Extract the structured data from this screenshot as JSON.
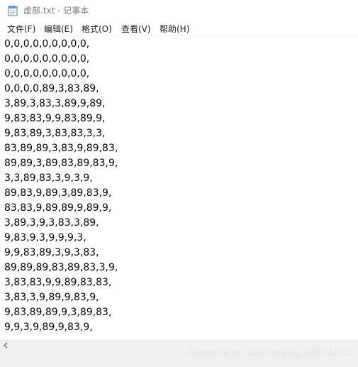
{
  "window": {
    "title": "虚部.txt - 记事本"
  },
  "menu": {
    "file": "文件(F)",
    "edit": "编辑(E)",
    "format": "格式(O)",
    "view": "查看(V)",
    "help": "帮助(H)"
  },
  "document": {
    "lines": [
      "0,0,0,0,0,0,0,0,0,",
      "0,0,0,0,0,0,0,0,0,",
      "0,0,0,0,0,0,0,0,0,",
      "0,0,0,0,89,3,83,89,",
      "3,89,3,83,3,89,9,89,",
      "9,83,83,9,9,83,89,9,",
      "9,83,89,3,83,83,3,3,",
      "83,89,89,3,83,9,89,83,",
      "89,89,3,89,83,89,83,9,",
      "3,3,89,83,3,9,3,9,",
      "89,83,9,89,3,89,83,9,",
      "83,83,9,89,89,9,89,9,",
      "3,89,3,9,3,83,3,89,",
      "9,83,9,3,9,9,9,3,",
      "9,9,83,89,3,9,3,83,",
      "89,89,89,83,89,83,3,9,",
      "3,83,83,9,9,89,83,83,",
      "3,83,3,9,89,9,83,9,",
      "9,83,89,89,9,3,89,83,",
      "9,9,3,9,89,9,83,9,"
    ]
  },
  "watermark": "https://blog.csdn.net/qq_24819549",
  "icons": {
    "app": "notepad-icon",
    "scroll_left": "chevron-left-icon"
  },
  "colors": {
    "title_text": "#7a7a7a",
    "chrome_gray": "#f0f0f0",
    "text": "#000000"
  }
}
